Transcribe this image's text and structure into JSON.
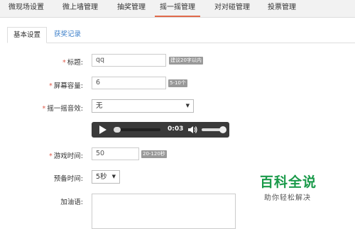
{
  "topnav": {
    "tabs": [
      {
        "label": "微现场设置",
        "active": false
      },
      {
        "label": "微上墙管理",
        "active": false
      },
      {
        "label": "抽奖管理",
        "active": false
      },
      {
        "label": "摇一摇管理",
        "active": true
      },
      {
        "label": "对对碰管理",
        "active": false
      },
      {
        "label": "投票管理",
        "active": false
      }
    ],
    "accent": "#e06a4a"
  },
  "subtabs": [
    {
      "label": "基本设置",
      "active": true
    },
    {
      "label": "获奖记录",
      "active": false
    }
  ],
  "form": {
    "title": {
      "label": "标题:",
      "value": "qq",
      "hint": "建议20字以内",
      "required": true
    },
    "screen_capacity": {
      "label": "屏幕容量:",
      "value": "6",
      "hint": "5-10个",
      "required": true
    },
    "shake_sound": {
      "label": "摇一摇音效:",
      "selected": "无",
      "required": true
    },
    "player": {
      "time": "0:03"
    },
    "game_time": {
      "label": "游戏时间:",
      "value": "50",
      "hint": "20-120秒",
      "required": true
    },
    "prep_time": {
      "label": "预备时间:",
      "selected": "5秒",
      "required": false
    },
    "cheer": {
      "label": "加油语:",
      "value": "",
      "required": false
    }
  },
  "watermark": {
    "title": "百科全说",
    "subtitle": "助你轻松解决"
  }
}
